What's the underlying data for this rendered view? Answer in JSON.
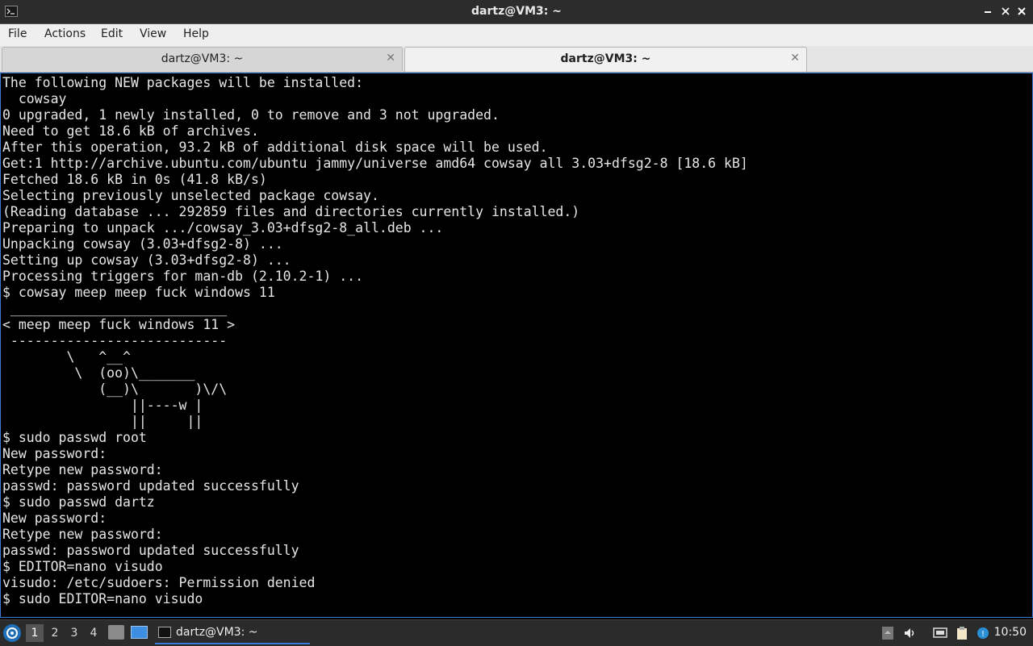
{
  "window": {
    "title": "dartz@VM3: ~"
  },
  "menu": {
    "items": [
      "File",
      "Actions",
      "Edit",
      "View",
      "Help"
    ]
  },
  "tabs": [
    {
      "label": "dartz@VM3: ~",
      "active": false
    },
    {
      "label": "dartz@VM3: ~",
      "active": true
    }
  ],
  "terminal": {
    "lines": [
      "The following NEW packages will be installed:",
      "  cowsay",
      "0 upgraded, 1 newly installed, 0 to remove and 3 not upgraded.",
      "Need to get 18.6 kB of archives.",
      "After this operation, 93.2 kB of additional disk space will be used.",
      "Get:1 http://archive.ubuntu.com/ubuntu jammy/universe amd64 cowsay all 3.03+dfsg2-8 [18.6 kB]",
      "Fetched 18.6 kB in 0s (41.8 kB/s)",
      "Selecting previously unselected package cowsay.",
      "(Reading database ... 292859 files and directories currently installed.)",
      "Preparing to unpack .../cowsay_3.03+dfsg2-8_all.deb ...",
      "Unpacking cowsay (3.03+dfsg2-8) ...",
      "Setting up cowsay (3.03+dfsg2-8) ...",
      "Processing triggers for man-db (2.10.2-1) ...",
      "$ cowsay meep meep fuck windows 11",
      " ___________________________",
      "< meep meep fuck windows 11 >",
      " ---------------------------",
      "        \\   ^__^",
      "         \\  (oo)\\_______",
      "            (__)\\       )\\/\\",
      "                ||----w |",
      "                ||     ||",
      "$ sudo passwd root",
      "New password:",
      "Retype new password:",
      "passwd: password updated successfully",
      "$ sudo passwd dartz",
      "New password:",
      "Retype new password:",
      "passwd: password updated successfully",
      "$ EDITOR=nano visudo",
      "visudo: /etc/sudoers: Permission denied",
      "$ sudo EDITOR=nano visudo"
    ]
  },
  "taskbar": {
    "workspaces": [
      "1",
      "2",
      "3",
      "4"
    ],
    "active_workspace": "1",
    "task_label": "dartz@VM3: ~",
    "clock": "10:50"
  },
  "colors": {
    "accent": "#3a7bd5",
    "terminal_bg": "#000000",
    "terminal_fg": "#e6e6e6"
  }
}
